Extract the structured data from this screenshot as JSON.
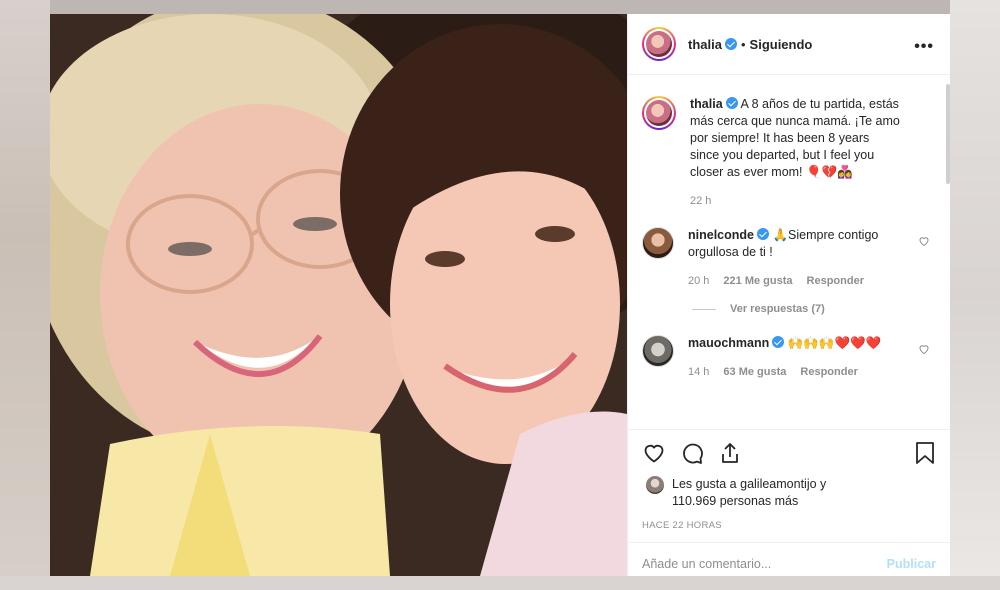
{
  "post": {
    "username": "thalia",
    "follow_status": "Siguiendo",
    "separator": "•"
  },
  "caption": {
    "username": "thalia",
    "text": "A 8 años de tu partida, estás más cerca que nunca mamá. ¡Te amo por siempre! It has been 8 years since you departed, but I feel you closer as ever mom! 🎈💔👩‍❤️‍👩",
    "time": "22 h"
  },
  "comments": [
    {
      "username": "ninelconde",
      "text": "🙏Siempre contigo orgullosa de ti !",
      "time": "20 h",
      "likes": "221 Me gusta",
      "reply_label": "Responder",
      "view_replies": "Ver respuestas (7)"
    },
    {
      "username": "mauochmann",
      "text": "🙌🙌🙌❤️❤️❤️",
      "time": "14 h",
      "likes": "63 Me gusta",
      "reply_label": "Responder"
    }
  ],
  "likes": {
    "prefix": "Les gusta a",
    "liked_by": "galileamontijo",
    "suffix": "y",
    "others_count": "110.969 personas más"
  },
  "timestamp": "HACE 22 HORAS",
  "add_comment": {
    "placeholder": "Añade un comentario...",
    "publish_label": "Publicar"
  },
  "icons": {
    "more": "more-options-icon",
    "like": "heart-icon",
    "comment": "comment-icon",
    "share": "share-icon",
    "save": "bookmark-icon",
    "verified": "verified-badge-icon"
  },
  "colors": {
    "verified": "#3897f0",
    "publish_disabled": "#b2dffc",
    "text": "#262626",
    "muted": "#8e8e8e"
  }
}
